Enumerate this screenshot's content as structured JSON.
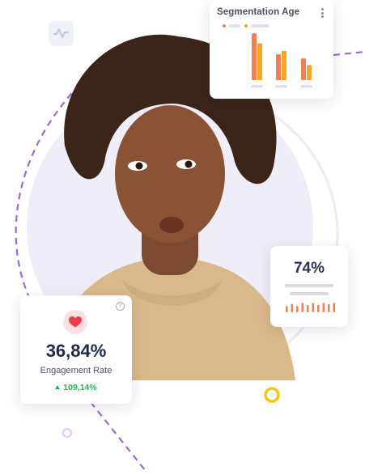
{
  "segmentation_card": {
    "title": "Segmentation Age",
    "legend_colors": [
      "#ee7f57",
      "#f5a623"
    ],
    "chart_data": {
      "type": "bar",
      "series": [
        {
          "color": "#ee7f57",
          "values": [
            56,
            31,
            26
          ]
        },
        {
          "color": "#f5a623",
          "values": [
            44,
            35,
            18
          ]
        }
      ],
      "ylim": [
        0,
        60
      ]
    }
  },
  "percent_card": {
    "value": "74%",
    "bar_color": "#ee7f57",
    "mini_bars": [
      6,
      8,
      6,
      9,
      7,
      9,
      7,
      9,
      8,
      9
    ]
  },
  "engagement_card": {
    "value": "36,84%",
    "label": "Engagement Rate",
    "change": "109,14%",
    "change_direction": "up",
    "heart_color": "#ee3b4a",
    "help_glyph": "?"
  },
  "icons": {
    "app_icon": "activity-pulse-icon"
  },
  "accent_colors": {
    "dashed_path": "#9a6bd0",
    "ring": "#f5c516",
    "small_ring": "#e2d0f5"
  }
}
